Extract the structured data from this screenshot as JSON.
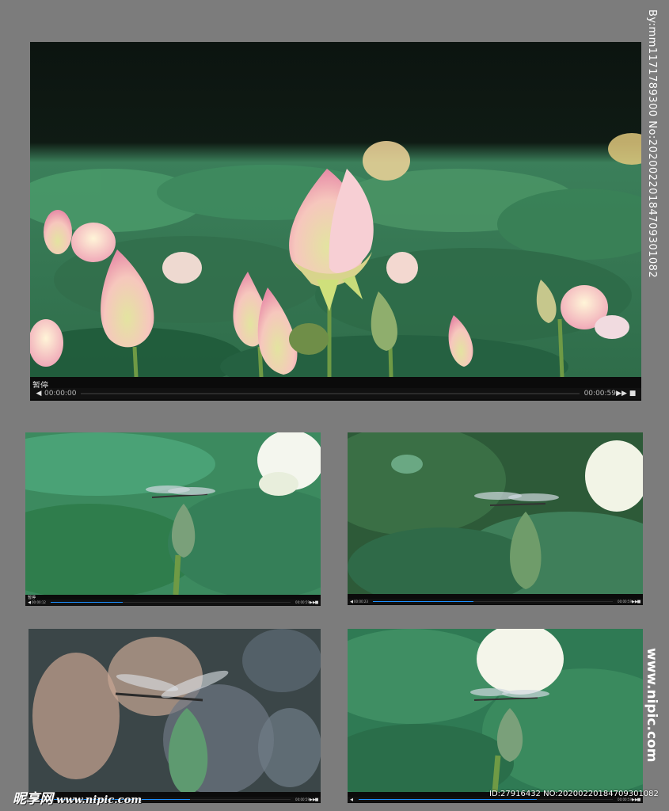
{
  "players": [
    {
      "status": "暂停",
      "current_time": "00:00:00",
      "duration": "00:00:59",
      "progress": 0.0
    },
    {
      "status": "暂停",
      "current_time": "00:00:12",
      "duration": "00:00:59",
      "progress": 0.3
    },
    {
      "status": "",
      "current_time": "00:00:23",
      "duration": "00:00:59",
      "progress": 0.42
    },
    {
      "status": "",
      "current_time": "",
      "duration": "00:00:59",
      "progress": 0.6
    },
    {
      "status": "",
      "current_time": "",
      "duration": "00:00:59",
      "progress": 0.7
    }
  ],
  "controls": {
    "prev_glyph": "◀",
    "next_glyph": "▶▶",
    "stop_glyph": "■"
  },
  "watermark": {
    "side_text": "By:mm1171789300 No:20200220184709301082",
    "site_vertical": "www.nipic.com",
    "logo_text": "昵享网",
    "logo_url": "www.nipic.com",
    "id_line": "ID:27916432 NO:20200220184709301082"
  },
  "colors": {
    "background": "#7c7c7c",
    "progress_fill": "#1e90ff",
    "bar": "#0b0b0b"
  }
}
